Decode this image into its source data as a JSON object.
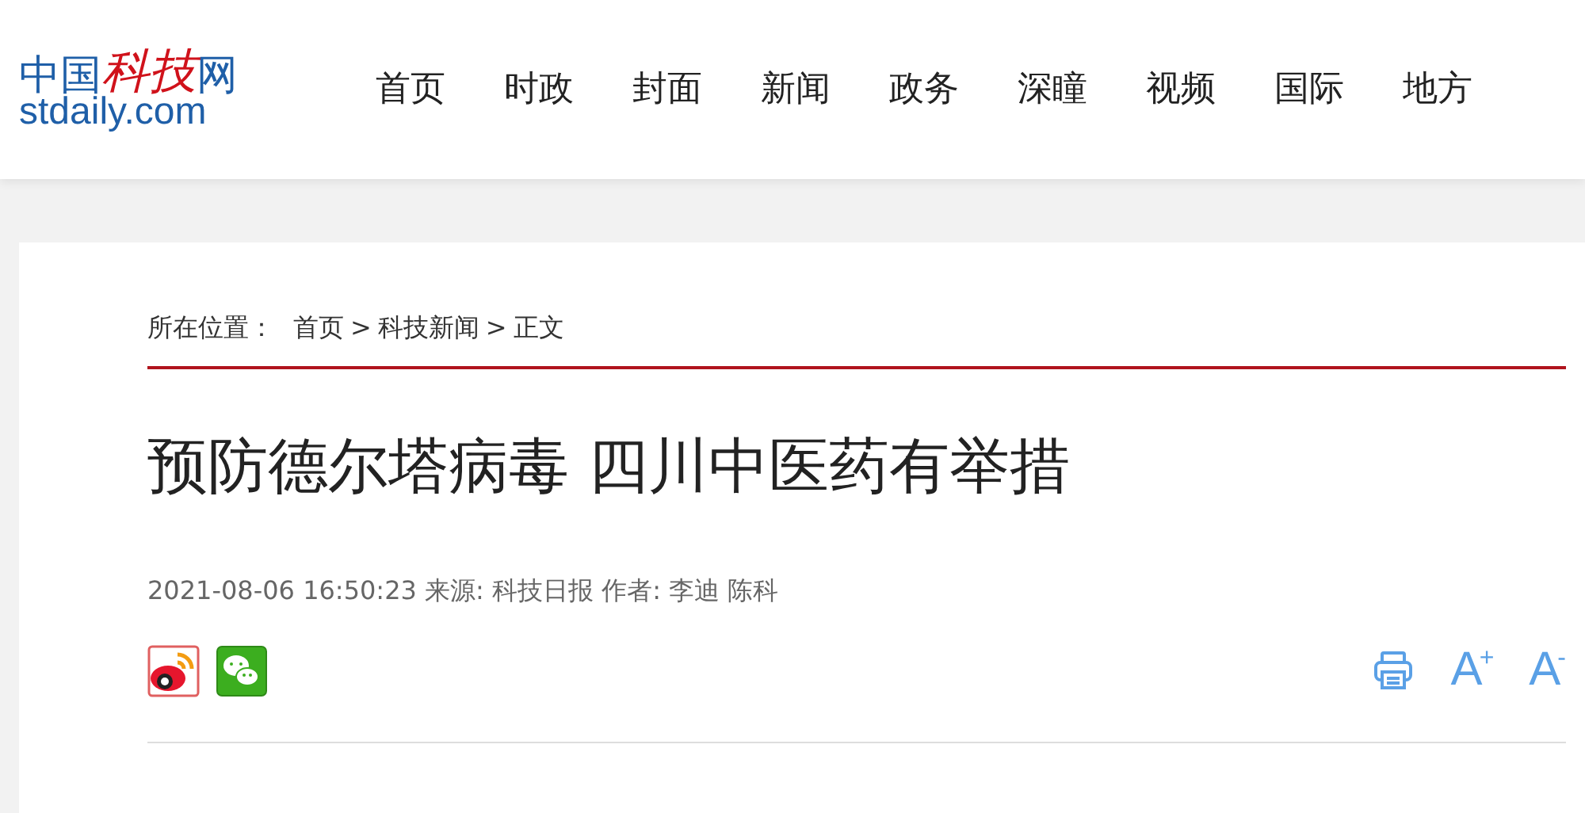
{
  "logo": {
    "chinese_plain_1": "中国",
    "chinese_brush": "科技",
    "chinese_plain_2": "网",
    "domain": "stdaily.com"
  },
  "nav": [
    "首页",
    "时政",
    "封面",
    "新闻",
    "政务",
    "深瞳",
    "视频",
    "国际",
    "地方"
  ],
  "breadcrumb": {
    "label": "所在位置：",
    "items": [
      "首页",
      "科技新闻",
      "正文"
    ],
    "separator": ">"
  },
  "article": {
    "title": "预防德尔塔病毒 四川中医药有举措",
    "meta": "2021-08-06 16:50:23 来源: 科技日报 作者: 李迪 陈科"
  },
  "font_buttons": [
    {
      "letter": "A",
      "sign": "+"
    },
    {
      "letter": "A",
      "sign": "-"
    }
  ]
}
